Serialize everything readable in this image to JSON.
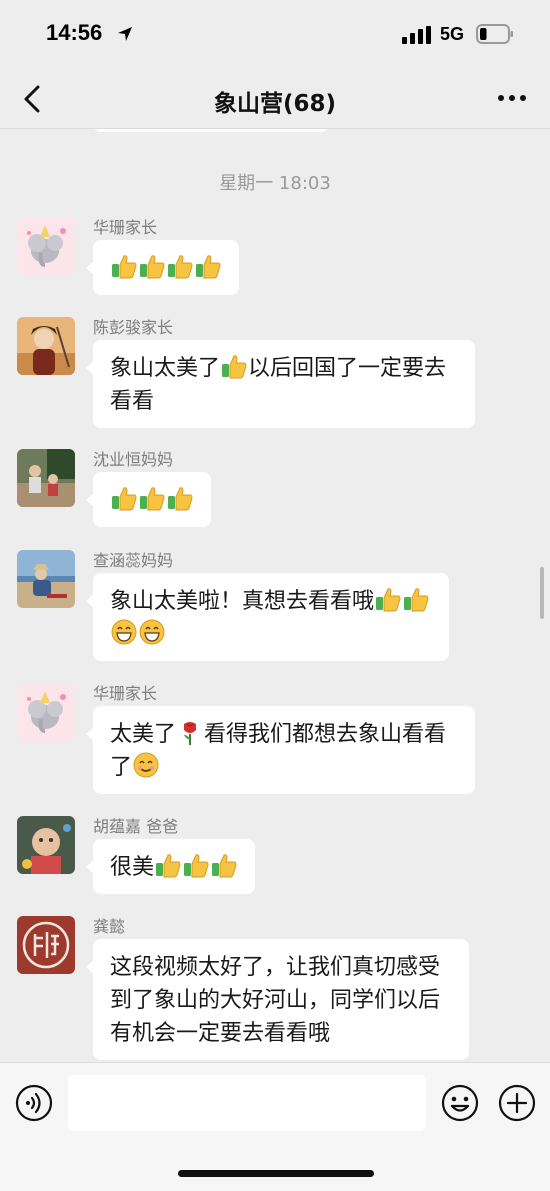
{
  "status_bar": {
    "time": "14:56",
    "network": "5G"
  },
  "header": {
    "title": "象山营(68)"
  },
  "messages_divider": "星期一 18:03",
  "messages": [
    {
      "sender": "华珊家长",
      "avatar": "elephant-avatar",
      "content": [
        {
          "e": "thumb"
        },
        {
          "e": "thumb"
        },
        {
          "e": "thumb"
        },
        {
          "e": "thumb"
        }
      ]
    },
    {
      "sender": "陈彭骏家长",
      "avatar": "warrior-avatar",
      "content": [
        {
          "t": "象山太美了"
        },
        {
          "e": "thumb"
        },
        {
          "t": "以后回国了一定要去看看"
        }
      ]
    },
    {
      "sender": "沈业恒妈妈",
      "avatar": "family-photo-avatar",
      "content": [
        {
          "e": "thumb"
        },
        {
          "e": "thumb"
        },
        {
          "e": "thumb"
        }
      ]
    },
    {
      "sender": "查涵蕊妈妈",
      "avatar": "beach-photo-avatar",
      "content": [
        {
          "t": "象山太美啦！真想去看看哦"
        },
        {
          "e": "thumb"
        },
        {
          "e": "thumb"
        },
        {
          "e": "grin"
        },
        {
          "e": "grin"
        }
      ]
    },
    {
      "sender": "华珊家长",
      "avatar": "elephant-avatar",
      "content": [
        {
          "t": "太美了"
        },
        {
          "e": "rose"
        },
        {
          "t": "看得我们都想去象山看看了"
        },
        {
          "e": "smile"
        }
      ]
    },
    {
      "sender": "胡蕴嘉 爸爸",
      "avatar": "baby-photo-avatar",
      "content": [
        {
          "t": "很美"
        },
        {
          "e": "thumb"
        },
        {
          "e": "thumb"
        },
        {
          "e": "thumb"
        }
      ]
    },
    {
      "sender": "龚懿",
      "avatar": "seal-avatar",
      "content": [
        {
          "t": "这段视频太好了，让我们真切感受到了象山的大好河山，同学们以后有机会一定要去看看哦"
        }
      ]
    }
  ],
  "input": {
    "placeholder": ""
  },
  "icons": {
    "back": "chevron-left-icon",
    "more": "more-dots-icon",
    "voice": "voice-icon",
    "emoji": "emoji-icon",
    "plus": "plus-icon",
    "location": "location-arrow-icon",
    "signal": "signal-icon",
    "battery": "battery-icon"
  },
  "colors": {
    "background": "#ededed",
    "bubble": "#ffffff",
    "sender": "#7d7d7d",
    "divider_text": "#9a9a9a"
  },
  "battery_level": 0.25
}
